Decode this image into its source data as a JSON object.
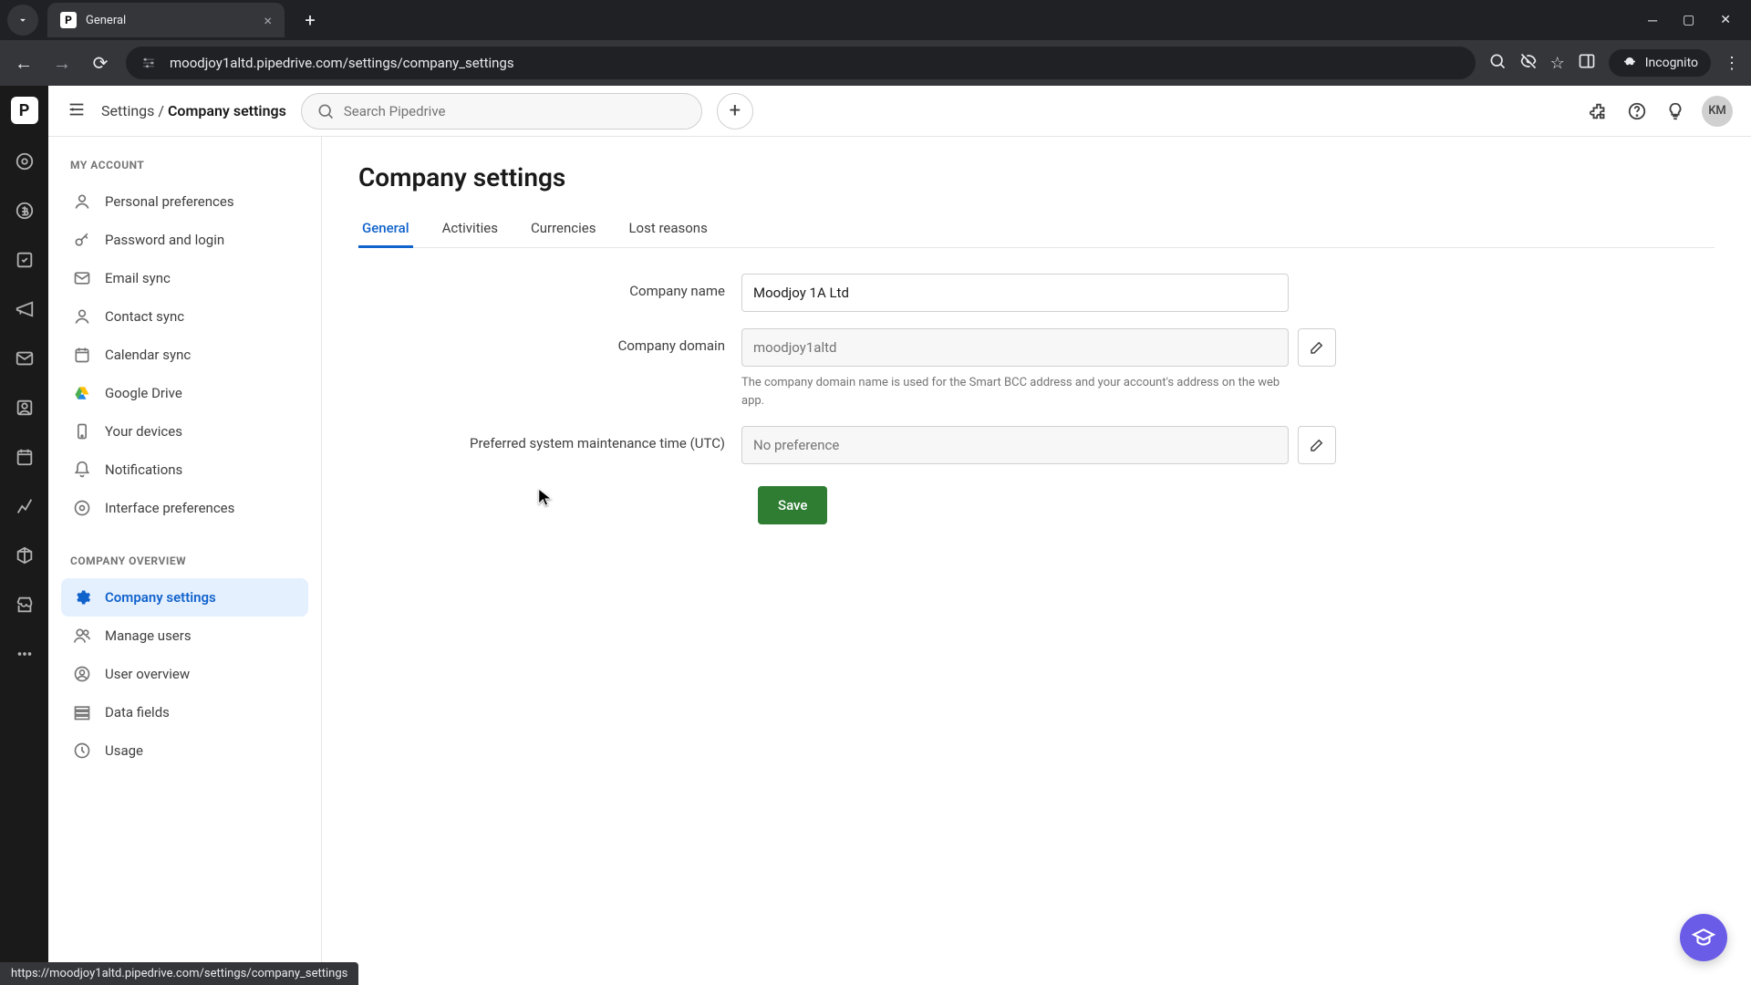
{
  "browser": {
    "tab_title": "General",
    "url": "moodjoy1altd.pipedrive.com/settings/company_settings",
    "incognito_label": "Incognito"
  },
  "topbar": {
    "breadcrumb_root": "Settings",
    "breadcrumb_current": "Company settings",
    "search_placeholder": "Search Pipedrive",
    "avatar_initials": "KM"
  },
  "sidebar": {
    "section1_header": "MY ACCOUNT",
    "section2_header": "COMPANY OVERVIEW",
    "items1": [
      {
        "label": "Personal preferences"
      },
      {
        "label": "Password and login"
      },
      {
        "label": "Email sync"
      },
      {
        "label": "Contact sync"
      },
      {
        "label": "Calendar sync"
      },
      {
        "label": "Google Drive"
      },
      {
        "label": "Your devices"
      },
      {
        "label": "Notifications"
      },
      {
        "label": "Interface preferences"
      }
    ],
    "items2": [
      {
        "label": "Company settings"
      },
      {
        "label": "Manage users"
      },
      {
        "label": "User overview"
      },
      {
        "label": "Data fields"
      },
      {
        "label": "Usage"
      }
    ]
  },
  "main": {
    "page_title": "Company settings",
    "tabs": [
      {
        "label": "General"
      },
      {
        "label": "Activities"
      },
      {
        "label": "Currencies"
      },
      {
        "label": "Lost reasons"
      }
    ],
    "company_name_label": "Company name",
    "company_name_value": "Moodjoy 1A Ltd",
    "company_domain_label": "Company domain",
    "company_domain_value": "moodjoy1altd",
    "company_domain_hint": "The company domain name is used for the Smart BCC address and your account's address on the web app.",
    "maintenance_label": "Preferred system maintenance time (UTC)",
    "maintenance_placeholder": "No preference",
    "save_label": "Save"
  },
  "status_url": "https://moodjoy1altd.pipedrive.com/settings/company_settings"
}
